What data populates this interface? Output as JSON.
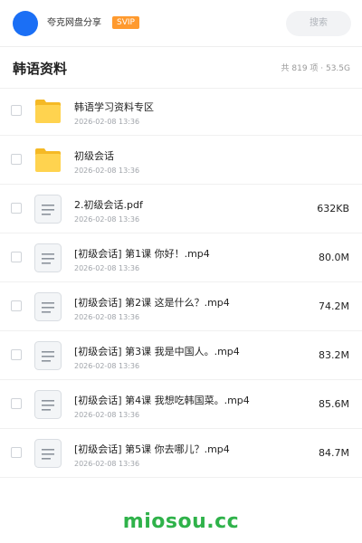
{
  "header": {
    "share_name": "夸克网盘分享",
    "badge": "SVIP",
    "search_placeholder": "搜索"
  },
  "folder": {
    "title": "韩语资料",
    "meta": "共 819 项 · 53.5G"
  },
  "items": [
    {
      "type": "folder",
      "icon": "folder-icon",
      "name": "韩语学习资料专区",
      "date": "2026-02-08 13:36",
      "size": ""
    },
    {
      "type": "folder",
      "icon": "folder-icon",
      "name": "初级会话",
      "date": "2026-02-08 13:36",
      "size": ""
    },
    {
      "type": "file",
      "icon": "document-icon",
      "name": "2.初级会话.pdf",
      "date": "2026-02-08 13:36",
      "size": "632KB"
    },
    {
      "type": "file",
      "icon": "document-icon",
      "name": "[初级会话] 第1课  你好！.mp4",
      "date": "2026-02-08 13:36",
      "size": "80.0M"
    },
    {
      "type": "file",
      "icon": "document-icon",
      "name": "[初级会话] 第2课  这是什么？.mp4",
      "date": "2026-02-08 13:36",
      "size": "74.2M"
    },
    {
      "type": "file",
      "icon": "document-icon",
      "name": "[初级会话] 第3课  我是中国人。.mp4",
      "date": "2026-02-08 13:36",
      "size": "83.2M"
    },
    {
      "type": "file",
      "icon": "document-icon",
      "name": "[初级会话] 第4课  我想吃韩国菜。.mp4",
      "date": "2026-02-08 13:36",
      "size": "85.6M"
    },
    {
      "type": "file",
      "icon": "document-icon",
      "name": "[初级会话] 第5课  你去哪儿？.mp4",
      "date": "2026-02-08 13:36",
      "size": "84.7M"
    }
  ],
  "watermark": "miosou.cc",
  "colors": {
    "accent": "#1b6ff5",
    "badge": "#ff9a2e",
    "folder": "#ffd34f",
    "watermark": "#2fb24a"
  }
}
